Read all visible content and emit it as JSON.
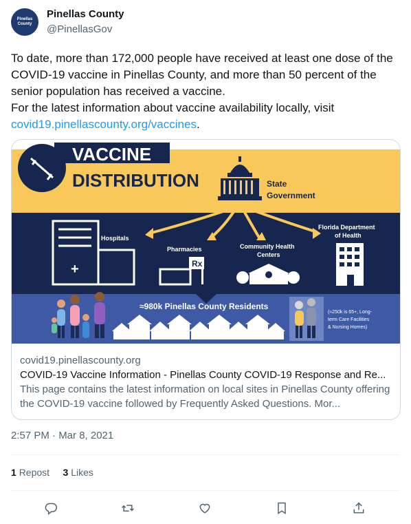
{
  "author": {
    "name": "Pinellas County",
    "handle": "@PinellasGov",
    "avatar_text": "Pinellas County"
  },
  "tweet": {
    "line1": "To date, more than 172,000 people have received at least one dose of the COVID-19 vaccine in Pinellas County, and more than 50 percent of the senior population has received a vaccine.",
    "line2": "For the latest information about vaccine availability locally, visit ",
    "link": "covid19.pinellascounty.org/vaccines",
    "after_link": "."
  },
  "card": {
    "image": {
      "title_line1": "VACCINE",
      "title_line2": "DISTRIBUTION",
      "state_label_1": "State",
      "state_label_2": "Government",
      "hospitals": "Hospitals",
      "pharmacies": "Pharmacies",
      "chc_1": "Community Health",
      "chc_2": "Centers",
      "fdoh_1": "Florida Department",
      "fdoh_2": "of Health",
      "residents": "≈980k Pinellas County Residents",
      "seniors_1": "(≈250k is 65+, Long-",
      "seniors_2": "term Care Facilities",
      "seniors_3": "& Nursing Homes)",
      "colors": {
        "navy": "#16264e",
        "gold": "#f8c85a",
        "band": "#3e5aa5"
      }
    },
    "domain": "covid19.pinellascounty.org",
    "title": "COVID-19 Vaccine Information - Pinellas County COVID-19 Response and Re...",
    "description": "This page contains the latest information on local sites in Pinellas County offering the COVID-19 vaccine followed by Frequently Asked Questions. Mor..."
  },
  "timestamp": "2:57 PM · Mar 8, 2021",
  "stats": {
    "reposts_count": "1",
    "reposts_label": "Repost",
    "likes_count": "3",
    "likes_label": "Likes"
  },
  "actions": [
    "reply-icon",
    "repost-icon",
    "like-icon",
    "bookmark-icon",
    "share-icon"
  ]
}
